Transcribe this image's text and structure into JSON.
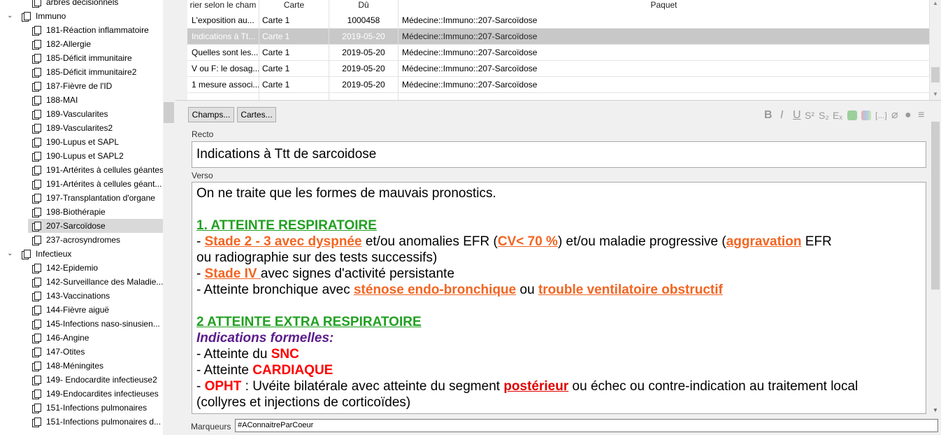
{
  "sidebar": {
    "items": [
      {
        "label": "arbres décisionnels",
        "level": 2,
        "type": "deck"
      },
      {
        "label": "Immuno",
        "level": 1,
        "type": "parent",
        "expanded": true
      },
      {
        "label": "181-Réaction inflammatoire",
        "level": 2,
        "type": "deck"
      },
      {
        "label": "182-Allergie",
        "level": 2,
        "type": "deck"
      },
      {
        "label": "185-Déficit immunitaire",
        "level": 2,
        "type": "deck"
      },
      {
        "label": "185-Déficit immunitaire2",
        "level": 2,
        "type": "deck"
      },
      {
        "label": "187-Fièvre de l'ID",
        "level": 2,
        "type": "deck"
      },
      {
        "label": "188-MAI",
        "level": 2,
        "type": "deck"
      },
      {
        "label": "189-Vascularites",
        "level": 2,
        "type": "deck"
      },
      {
        "label": "189-Vascularites2",
        "level": 2,
        "type": "deck"
      },
      {
        "label": "190-Lupus et SAPL",
        "level": 2,
        "type": "deck"
      },
      {
        "label": "190-Lupus et SAPL2",
        "level": 2,
        "type": "deck"
      },
      {
        "label": "191-Artérites à cellules géantes",
        "level": 2,
        "type": "deck"
      },
      {
        "label": "191-Artérites à cellules géant...",
        "level": 2,
        "type": "deck"
      },
      {
        "label": "197-Transplantation d'organe",
        "level": 2,
        "type": "deck"
      },
      {
        "label": "198-Biothérapie",
        "level": 2,
        "type": "deck"
      },
      {
        "label": "207-Sarcoïdose",
        "level": 2,
        "type": "deck",
        "selected": true
      },
      {
        "label": "237-acrosyndromes",
        "level": 2,
        "type": "deck"
      },
      {
        "label": "Infectieux",
        "level": 1,
        "type": "parent",
        "expanded": true
      },
      {
        "label": "142-Epidemio",
        "level": 2,
        "type": "deck"
      },
      {
        "label": "142-Surveillance des Maladie...",
        "level": 2,
        "type": "deck"
      },
      {
        "label": "143-Vaccinations",
        "level": 2,
        "type": "deck"
      },
      {
        "label": "144-Fièvre aiguë",
        "level": 2,
        "type": "deck"
      },
      {
        "label": "145-Infections naso-sinusien...",
        "level": 2,
        "type": "deck"
      },
      {
        "label": "146-Angine",
        "level": 2,
        "type": "deck"
      },
      {
        "label": "147-Otites",
        "level": 2,
        "type": "deck"
      },
      {
        "label": "148-Méningites",
        "level": 2,
        "type": "deck"
      },
      {
        "label": "149- Endocardite infectieuse2",
        "level": 2,
        "type": "deck"
      },
      {
        "label": "149-Endocardites infectieuses",
        "level": 2,
        "type": "deck"
      },
      {
        "label": "151-Infections pulmonaires",
        "level": 2,
        "type": "deck"
      },
      {
        "label": "151-Infections pulmonaires d...",
        "level": 2,
        "type": "deck"
      }
    ]
  },
  "table": {
    "headers": [
      "rier selon le cham",
      "Carte",
      "Dû",
      "Paquet"
    ],
    "rows": [
      {
        "c0": "L'exposition au...",
        "c1": "Carte 1",
        "c2": "1000458",
        "c3": "Médecine::Immuno::207-Sarcoïdose",
        "selected": false
      },
      {
        "c0": "Indications à Tt...",
        "c1": "Carte 1",
        "c2": "2019-05-20",
        "c3": "Médecine::Immuno::207-Sarcoïdose",
        "selected": true
      },
      {
        "c0": "Quelles sont les...",
        "c1": "Carte 1",
        "c2": "2019-05-20",
        "c3": "Médecine::Immuno::207-Sarcoïdose",
        "selected": false
      },
      {
        "c0": "V ou F: le dosag...",
        "c1": "Carte 1",
        "c2": "2019-05-20",
        "c3": "Médecine::Immuno::207-Sarcoïdose",
        "selected": false
      },
      {
        "c0": "1 mesure associ...",
        "c1": "Carte 1",
        "c2": "2019-05-20",
        "c3": "Médecine::Immuno::207-Sarcoïdose",
        "selected": false
      },
      {
        "c0": "",
        "c1": "",
        "c2": "",
        "c3": "",
        "selected": false
      }
    ]
  },
  "editor": {
    "fields_button": "Champs...",
    "cards_button": "Cartes...",
    "toolbar": {
      "bold": "B",
      "italic": "I",
      "underline": "U",
      "superscript": "S²",
      "subscript": "S₂",
      "clear": "Eₓ"
    },
    "recto_label": "Recto",
    "recto_value": "Indications à Ttt de sarcoidose",
    "verso_label": "Verso",
    "verso": {
      "l1": "On ne traite que les formes de mauvais pronostics.",
      "h1": "1. ATTEINTE RESPIRATOIRE",
      "l2a": "- ",
      "l2b": "Stade 2 - 3 avec dyspnée",
      "l2c": " et/ou anomalies EFR (",
      "l2d": "CV< 70 %",
      "l2e": ") et/ou maladie progressive (",
      "l2f": "aggravation",
      "l2g": " EFR",
      "l3": "ou radiographie sur des tests successifs)",
      "l4a": "- ",
      "l4b": "Stade IV ",
      "l4c": "avec signes d'activité persistante",
      "l5a": "- Atteinte bronchique avec ",
      "l5b": "sténose endo-bronchique",
      "l5c": " ou ",
      "l5d": "trouble ventilatoire obstructif",
      "h2": "2  ATTEINTE EXTRA RESPIRATOIRE",
      "h3": "Indications formelles:",
      "l6a": "- Atteinte du ",
      "l6b": "SNC",
      "l7a": "- Atteinte ",
      "l7b": "CARDIAQUE",
      "l8a": "- ",
      "l8b": "OPHT",
      "l8c": " : Uvéite bilatérale avec atteinte du segment ",
      "l8d": "postérieur",
      "l8e": " ou échec ou contre-indication au traitement local",
      "l9": "(collyres et injections de corticoïdes)"
    },
    "tags_label": "Marqueurs",
    "tags_value": "#AConnaitreParCoeur"
  }
}
